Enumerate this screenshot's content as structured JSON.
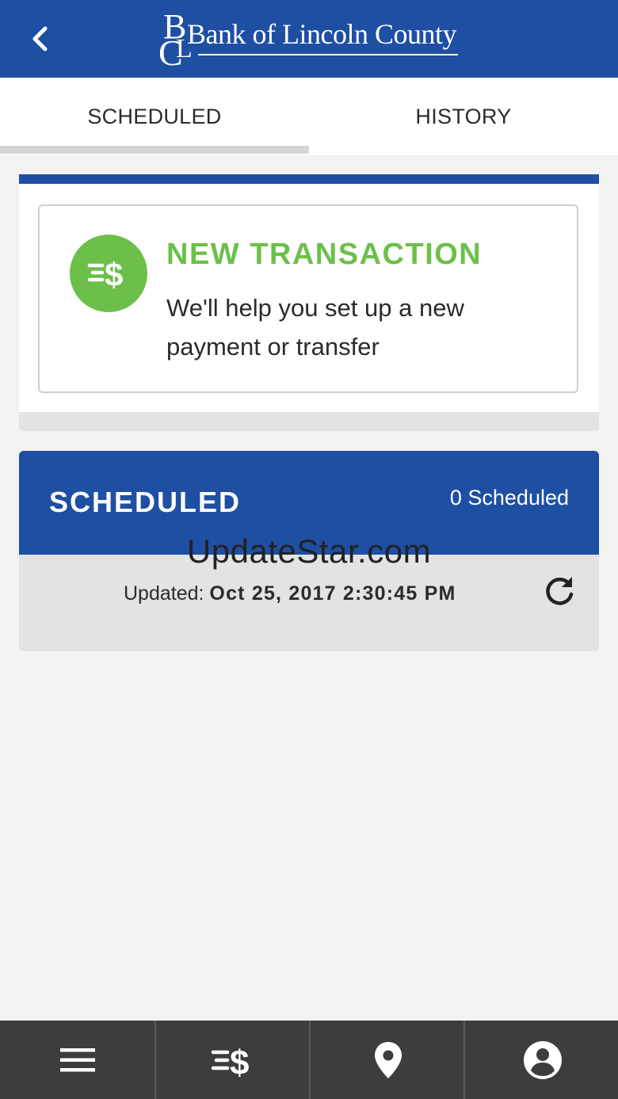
{
  "header": {
    "logo_text": "Bank of Lincoln County",
    "back_icon": "chevron-left-icon",
    "background_color": "#1e4fa3"
  },
  "tabs": [
    {
      "label": "SCHEDULED",
      "active": true
    },
    {
      "label": "HISTORY",
      "active": false
    }
  ],
  "new_transaction": {
    "icon": "transfer-dollar-icon",
    "title": "NEW TRANSACTION",
    "description": "We'll help you set up a new payment or transfer",
    "accent_color": "#6cc04a"
  },
  "scheduled": {
    "title": "SCHEDULED",
    "count_label": "0 Scheduled",
    "updated_label": "Updated:",
    "updated_value": "Oct 25, 2017 2:30:45 PM",
    "refresh_icon": "refresh-icon"
  },
  "watermark": "UpdateStar.com",
  "bottom_nav": [
    {
      "icon": "menu-icon"
    },
    {
      "icon": "transfer-dollar-icon"
    },
    {
      "icon": "location-pin-icon"
    },
    {
      "icon": "account-icon"
    }
  ]
}
